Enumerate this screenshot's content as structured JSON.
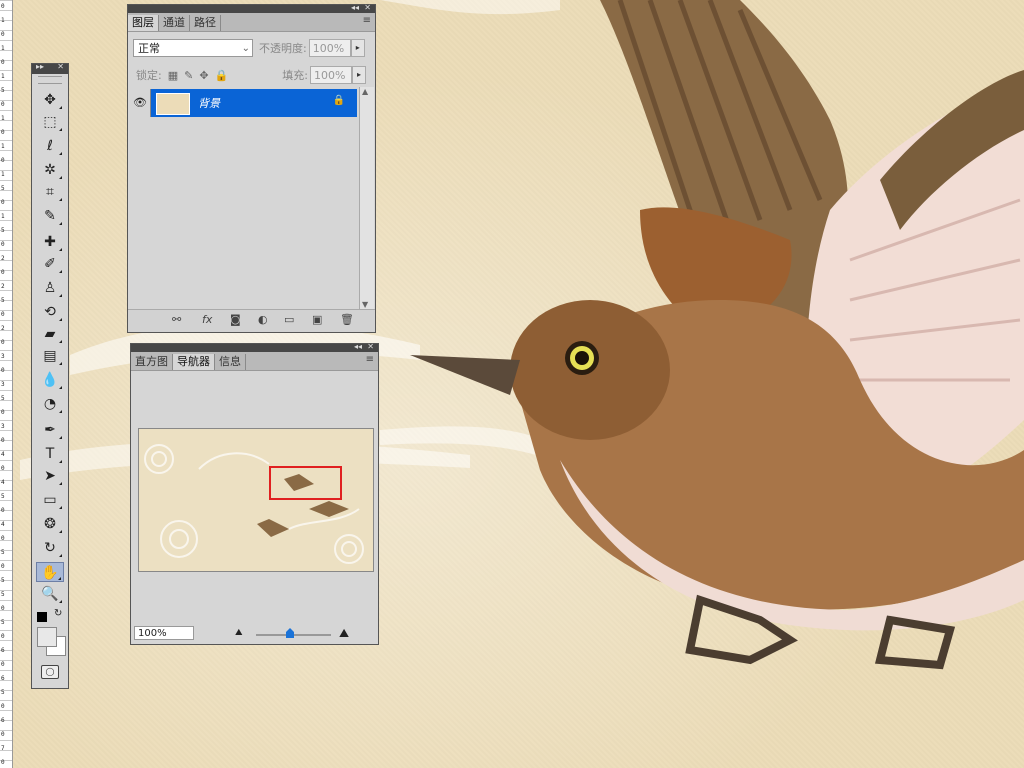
{
  "canvas": {
    "background_color": "#ecdcb8"
  },
  "ruler": {
    "labels": [
      "0",
      "1",
      "0",
      "1",
      "0",
      "1",
      "5",
      "0",
      "1",
      "0",
      "1",
      "0",
      "1",
      "5",
      "0",
      "1",
      "5",
      "0",
      "2",
      "0",
      "2",
      "5",
      "0",
      "2",
      "0",
      "3",
      "0",
      "3",
      "5",
      "0",
      "3",
      "0",
      "4",
      "0",
      "4",
      "5",
      "0",
      "4",
      "0",
      "5",
      "0",
      "5",
      "5",
      "0",
      "5",
      "0",
      "6",
      "0",
      "6",
      "5",
      "0",
      "6",
      "0",
      "7",
      "0"
    ]
  },
  "toolbox": {
    "tools": [
      {
        "name": "move-tool",
        "glyph": "✥"
      },
      {
        "name": "marquee-tool",
        "glyph": "⬚"
      },
      {
        "name": "lasso-tool",
        "glyph": "ℓ"
      },
      {
        "name": "quick-select-tool",
        "glyph": "✲"
      },
      {
        "name": "crop-tool",
        "glyph": "⌗"
      },
      {
        "name": "eyedropper-tool",
        "glyph": "✎"
      },
      {
        "name": "healing-brush-tool",
        "glyph": "✚"
      },
      {
        "name": "brush-tool",
        "glyph": "✐"
      },
      {
        "name": "clone-stamp-tool",
        "glyph": "♙"
      },
      {
        "name": "history-brush-tool",
        "glyph": "⟲"
      },
      {
        "name": "eraser-tool",
        "glyph": "▰"
      },
      {
        "name": "gradient-tool",
        "glyph": "▤"
      },
      {
        "name": "blur-tool",
        "glyph": "💧"
      },
      {
        "name": "dodge-tool",
        "glyph": "◔"
      },
      {
        "name": "pen-tool",
        "glyph": "✒"
      },
      {
        "name": "type-tool",
        "glyph": "T"
      },
      {
        "name": "path-select-tool",
        "glyph": "➤"
      },
      {
        "name": "shape-tool",
        "glyph": "▭"
      },
      {
        "name": "3d-rotate-tool",
        "glyph": "❂"
      },
      {
        "name": "3d-orbit-tool",
        "glyph": "↻"
      },
      {
        "name": "hand-tool",
        "glyph": "✋"
      },
      {
        "name": "zoom-tool",
        "glyph": "🔍"
      }
    ],
    "foreground_color": "#000000",
    "background_color": "#ffffff",
    "swatch_front_color": "#e8e8e8"
  },
  "layers_panel": {
    "tabs": [
      "图层",
      "通道",
      "路径"
    ],
    "blend_mode": "正常",
    "opacity_label": "不透明度:",
    "opacity_value": "100%",
    "lock_label": "锁定:",
    "fill_label": "填充:",
    "fill_value": "100%",
    "layers": [
      {
        "name": "背景",
        "visible": true,
        "locked": true,
        "selected": true
      }
    ],
    "footer_icons": [
      "link-icon",
      "fx-icon",
      "mask-icon",
      "adjustment-icon",
      "group-icon",
      "new-layer-icon",
      "trash-icon"
    ],
    "footer_fx_label": "fx"
  },
  "navigator_panel": {
    "tabs": [
      "直方图",
      "导航器",
      "信息"
    ],
    "zoom_value": "100%",
    "view_box_color": "#e02020"
  }
}
